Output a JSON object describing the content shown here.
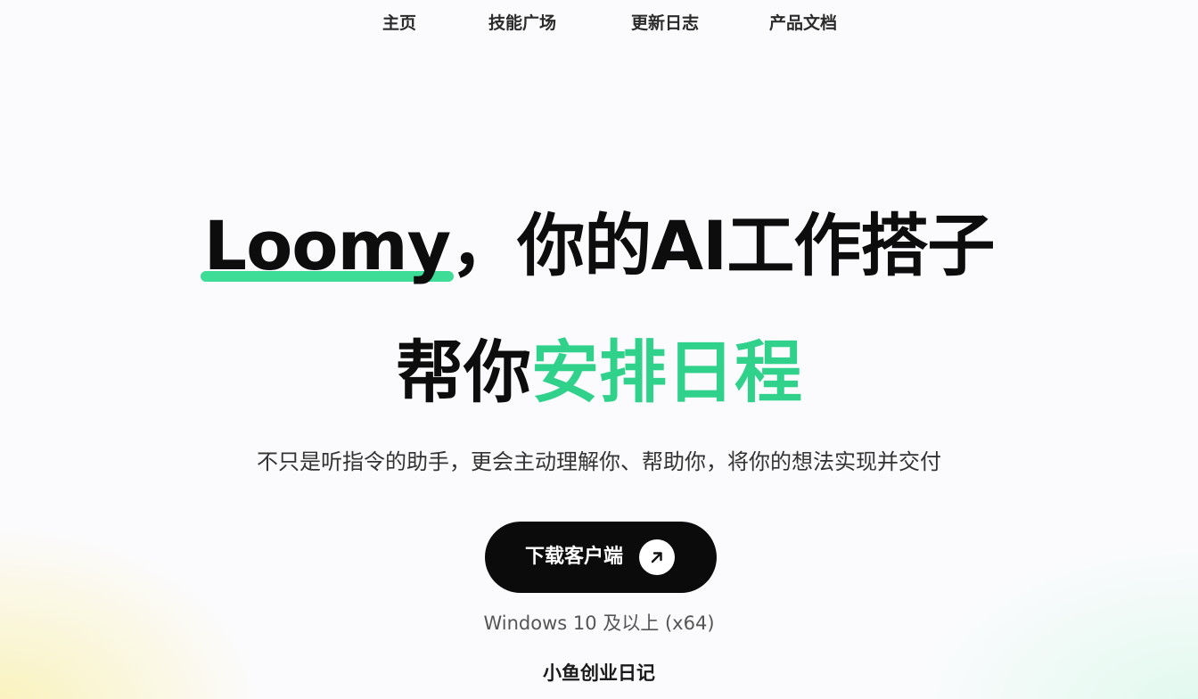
{
  "nav": {
    "home": "主页",
    "skills": "技能广场",
    "updates": "更新日志",
    "docs": "产品文档"
  },
  "hero": {
    "brand": "Loomy",
    "headline_rest": "，你的AI工作搭子",
    "line2_prefix": "帮你",
    "line2_accent": "安排日程",
    "subtitle": "不只是听指令的助手，更会主动理解你、帮助你，将你的想法实现并交付"
  },
  "download": {
    "label": "下载客户端",
    "icon": "arrow-up-right-icon",
    "platform": "Windows 10 及以上 (x64)"
  },
  "footer": {
    "watermark": "小鱼创业日记"
  },
  "colors": {
    "accent": "#2fd18b",
    "button_bg": "#0b0b0b",
    "text": "#0d0d0d"
  }
}
